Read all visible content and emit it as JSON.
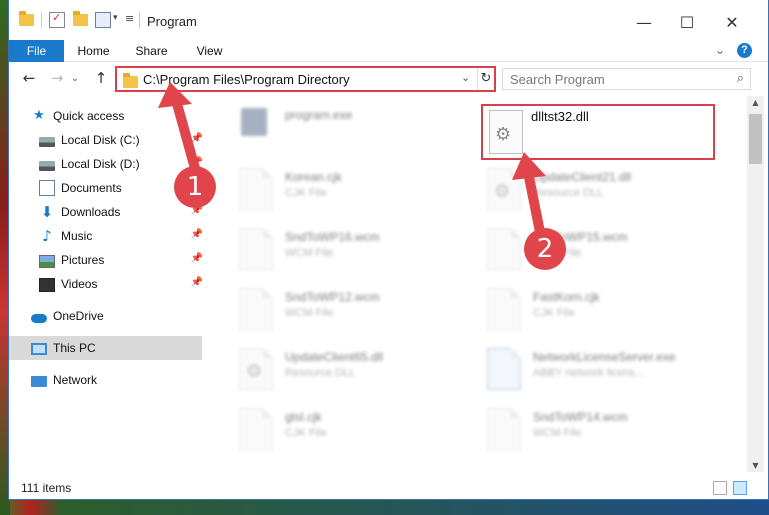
{
  "window": {
    "title": "Program",
    "controls": {
      "minimize": "—",
      "maximize": "☐",
      "close": "✕"
    }
  },
  "ribbon": {
    "tabs": [
      "File",
      "Home",
      "Share",
      "View"
    ],
    "collapse": "⌄",
    "help": "?"
  },
  "nav": {
    "back": "←",
    "forward": "→",
    "recent": "⌄",
    "up": "↑",
    "address": "C:\\Program Files\\Program Directory",
    "address_dropdown": "⌄",
    "refresh": "↻",
    "search_placeholder": "Search Program",
    "search_icon": "⌕"
  },
  "sidebar": {
    "items": [
      {
        "label": "Quick access",
        "icon": "star-icon",
        "pinned": false
      },
      {
        "label": "Local Disk (C:)",
        "icon": "disk-icon",
        "pinned": true
      },
      {
        "label": "Local Disk (D:)",
        "icon": "disk-icon",
        "pinned": true
      },
      {
        "label": "Documents",
        "icon": "documents-icon",
        "pinned": true
      },
      {
        "label": "Downloads",
        "icon": "downloads-icon",
        "pinned": true
      },
      {
        "label": "Music",
        "icon": "music-icon",
        "pinned": true
      },
      {
        "label": "Pictures",
        "icon": "pictures-icon",
        "pinned": true
      },
      {
        "label": "Videos",
        "icon": "videos-icon",
        "pinned": true
      },
      {
        "label": "OneDrive",
        "icon": "onedrive-icon",
        "pinned": false
      },
      {
        "label": "This PC",
        "icon": "this-pc-icon",
        "pinned": false
      },
      {
        "label": "Network",
        "icon": "network-icon",
        "pinned": false
      }
    ],
    "pin_glyph": "📌"
  },
  "files": {
    "left": [
      {
        "name": "program.exe",
        "type": ""
      },
      {
        "name": "Korean.cjk",
        "type": "CJK File"
      },
      {
        "name": "SndToWP16.wcm",
        "type": "WCM File"
      },
      {
        "name": "SndToWP12.wcm",
        "type": "WCM File"
      },
      {
        "name": "UpdateClient65.dll",
        "type": "Resource DLL"
      },
      {
        "name": "gtsl.cjk",
        "type": "CJK File"
      }
    ],
    "right": [
      {
        "name": "UpdateClient21.dll",
        "type": "Resource DLL"
      },
      {
        "name": "SndToWP15.wcm",
        "type": "WCM File"
      },
      {
        "name": "FastKorn.cjk",
        "type": "CJK File"
      },
      {
        "name": "NetworkLicenseServer.exe",
        "type": "ABBY network licens..."
      },
      {
        "name": "SndToWP14.wcm",
        "type": "WCM File"
      }
    ],
    "target": {
      "name": "dlltst32.dll"
    }
  },
  "status": {
    "count": "111 items"
  },
  "annotations": {
    "step1": "1",
    "step2": "2"
  },
  "colors": {
    "accent": "#1979ca",
    "highlight": "#d9404a",
    "arrow": "#e0454c"
  }
}
